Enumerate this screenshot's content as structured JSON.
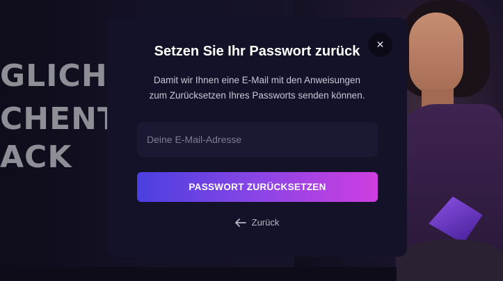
{
  "background": {
    "hero_lines": [
      "GLICH",
      "CHENT",
      "ACK"
    ]
  },
  "modal": {
    "title": "Setzen Sie Ihr Passwort zurück",
    "subtitle_line1": "Damit wir Ihnen eine E-Mail mit den Anweisungen",
    "subtitle_line2": "zum Zurücksetzen Ihres Passworts senden können.",
    "close_icon": "close-icon",
    "email_placeholder": "Deine E-Mail-Adresse",
    "email_value": "",
    "submit_label": "PASSWORT ZURÜCKSETZEN",
    "back_label": "Zurück",
    "back_icon": "arrow-left-icon"
  },
  "colors": {
    "modal_bg": "#131228",
    "button_gradient_start": "#4b3fe0",
    "button_gradient_end": "#cf3ee0"
  }
}
